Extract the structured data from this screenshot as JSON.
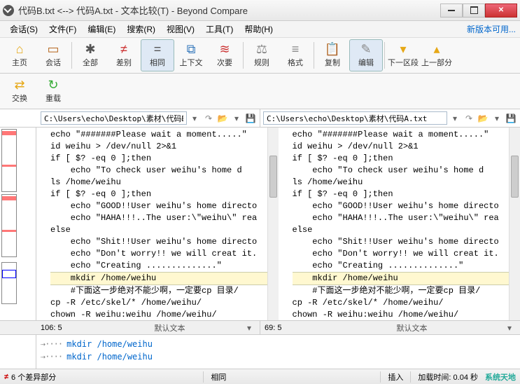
{
  "window": {
    "title": "代码B.txt <--> 代码A.txt - 文本比较(T) - Beyond Compare"
  },
  "menu": {
    "items": [
      "会话(S)",
      "文件(F)",
      "编辑(E)",
      "搜索(R)",
      "视图(V)",
      "工具(T)",
      "帮助(H)"
    ],
    "newver": "新版本可用..."
  },
  "toolbar": {
    "home": "主页",
    "session": "会话",
    "all": "全部",
    "diffs": "差别",
    "same": "相同",
    "context": "上下文",
    "minor": "次要",
    "rules": "规则",
    "format": "格式",
    "copy": "复制",
    "edit": "编辑",
    "next": "下一区段",
    "prev": "上一部分",
    "swap": "交换",
    "reload": "重载"
  },
  "paths": {
    "left": "C:\\Users\\echo\\Desktop\\素材\\代码B.txt",
    "right": "C:\\Users\\echo\\Desktop\\素材\\代码A.txt"
  },
  "code": {
    "left": [
      "echo \"#######Please wait a moment.....\"",
      "id weihu > /dev/null 2>&1",
      "if [ $? -eq 0 ];then",
      "    echo \"To check user weihu's home d",
      "",
      "ls /home/weihu",
      "if [ $? -eq 0 ];then",
      "    echo \"GOOD!!User weihu's home directo",
      "    echo \"HAHA!!!..The user:\\\"weihu\\\" rea",
      "else",
      "    echo \"Shit!!User weihu's home directo",
      "    echo \"Don't worry!! we will creat it.",
      "    echo \"Creating ..............\"",
      "    mkdir /home/weihu",
      "    #下面这一步绝对不能少啊，一定要cp 目录/",
      "cp -R /etc/skel/* /home/weihu/",
      "chown -R weihu:weihu /home/weihu/"
    ],
    "right": [
      "echo \"#######Please wait a moment.....\"",
      "id weihu > /dev/null 2>&1",
      "if [ $? -eq 0 ];then",
      "    echo \"To check user weihu's home d",
      "",
      "ls /home/weihu",
      "if [ $? -eq 0 ];then",
      "    echo \"GOOD!!User weihu's home directo",
      "    echo \"HAHA!!!..The user:\\\"weihu\\\" rea",
      "else",
      "    echo \"Shit!!User weihu's home directo",
      "    echo \"Don't worry!! we will creat it.",
      "    echo \"Creating ..............\"",
      "    mkdir /home/weihu",
      "    #下面这一步绝对不能少啊，一定要cp 目录/",
      "cp -R /etc/skel/* /home/weihu/",
      "chown -R weihu:weihu /home/weihu/"
    ],
    "hl_index": 13
  },
  "panestat": {
    "left_pos": "106: 5",
    "right_pos": "69: 5",
    "fmt": "默认文本"
  },
  "diffdetail": {
    "line1": "mkdir /home/weihu",
    "line2": "mkdir /home/weihu"
  },
  "status": {
    "diffs": "6 个差异部分",
    "same": "相同",
    "insert": "插入",
    "load": "加载时间: 0.04 秒",
    "brand": "系统天地"
  }
}
